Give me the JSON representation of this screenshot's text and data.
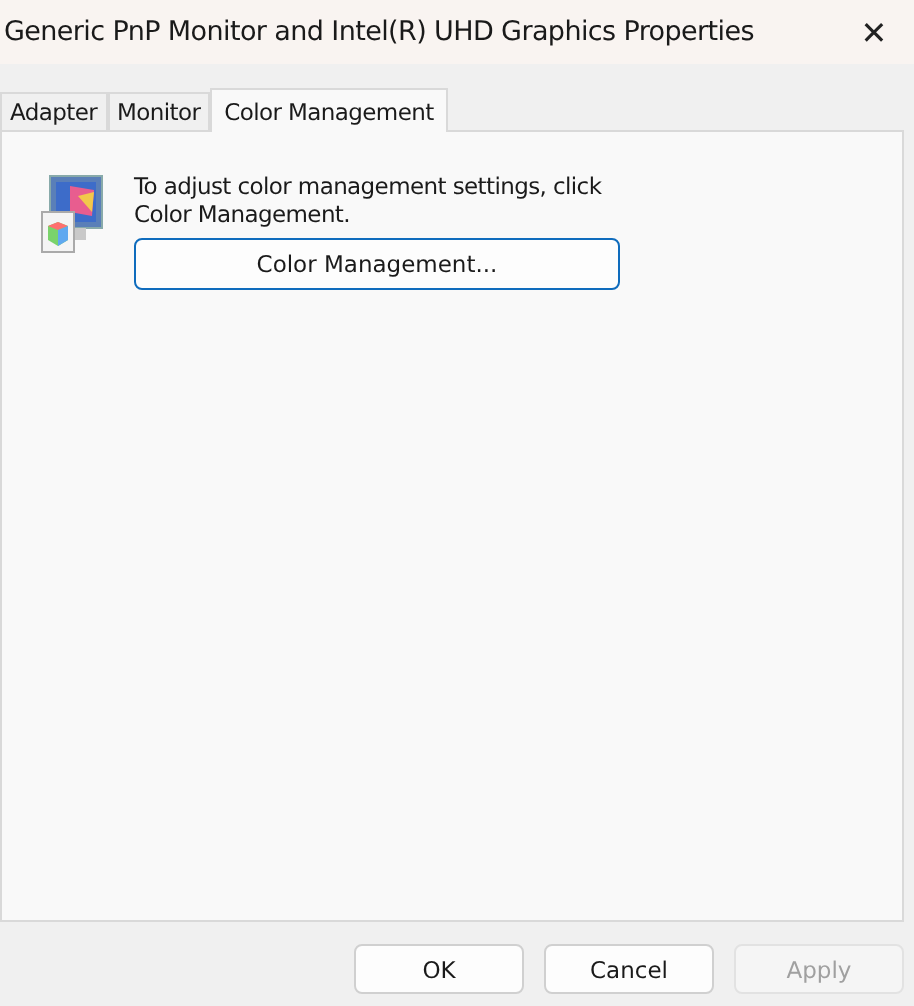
{
  "window": {
    "title": "Generic PnP Monitor and Intel(R) UHD Graphics Properties",
    "close": "✕"
  },
  "tabs": [
    {
      "label": "Adapter",
      "selected": false
    },
    {
      "label": "Monitor",
      "selected": false
    },
    {
      "label": "Color Management",
      "selected": true
    }
  ],
  "panel": {
    "description": "To adjust color management settings, click Color Management.",
    "button": "Color Management..."
  },
  "buttons": [
    {
      "label": "OK",
      "disabled": false
    },
    {
      "label": "Cancel",
      "disabled": false
    },
    {
      "label": "Apply",
      "disabled": true
    }
  ]
}
